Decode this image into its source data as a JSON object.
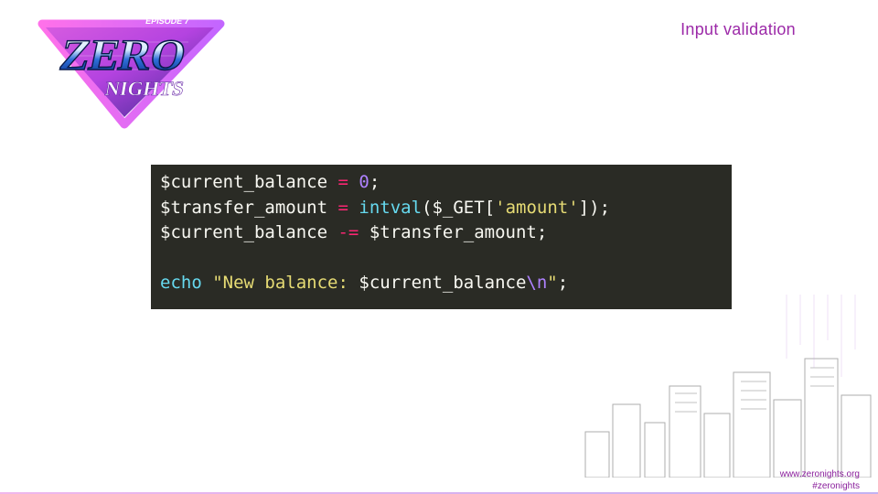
{
  "logo": {
    "episode_text": "EPISODE 7",
    "word_top": "ZERO",
    "word_bottom": "NIGHTS"
  },
  "header": {
    "label": "Input validation"
  },
  "code": {
    "line1": {
      "var": "$current_balance",
      "op": "=",
      "value": "0",
      "semi": ";"
    },
    "line2": {
      "var": "$transfer_amount",
      "op": "=",
      "func": "intval",
      "open": "(",
      "arg_var": "$_GET",
      "bracket_open": "[",
      "key": "'amount'",
      "bracket_close": "]",
      "close": ")",
      "semi": ";"
    },
    "line3": {
      "var_l": "$current_balance",
      "op": "-=",
      "var_r": "$transfer_amount",
      "semi": ";"
    },
    "line5": {
      "kw": "echo",
      "str_open": "\"New balance: ",
      "interp_var": "$current_balance",
      "esc": "\\n",
      "str_close": "\"",
      "semi": ";"
    }
  },
  "footer": {
    "url": "www.zeronights.org",
    "hashtag": "#zeronights"
  }
}
